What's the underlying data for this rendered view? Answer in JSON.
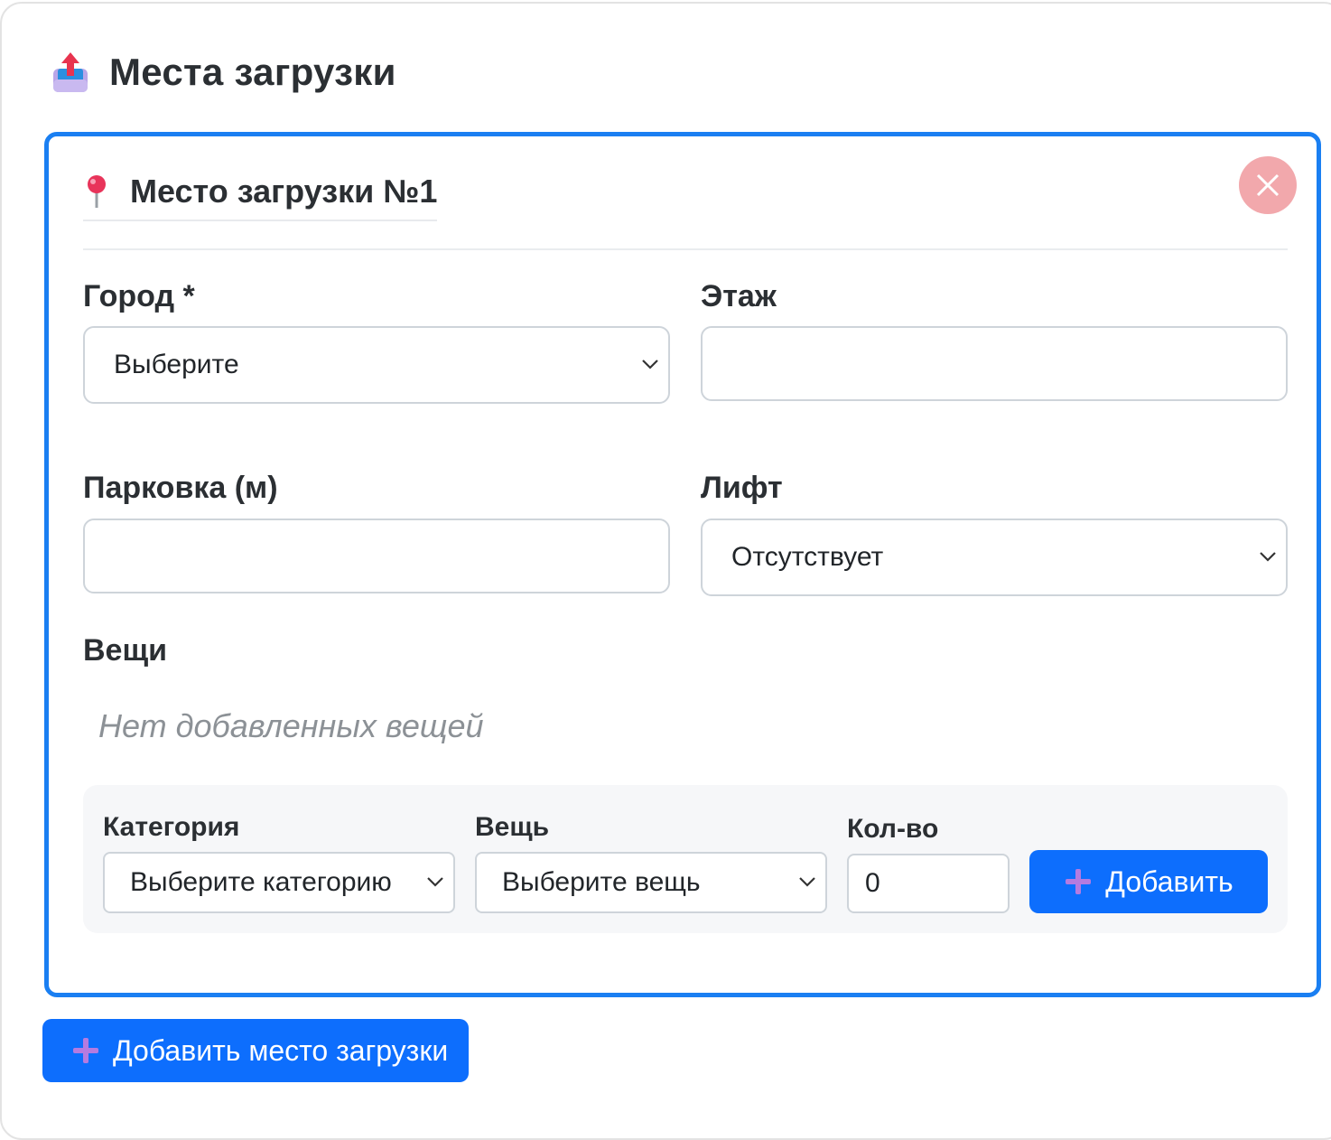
{
  "section": {
    "title": "Места загрузки",
    "icon": "outbox-tray-icon"
  },
  "location_card": {
    "title": "Место загрузки №1",
    "icon": "round-pushpin-icon",
    "remove_icon": "close-icon",
    "fields": {
      "city": {
        "label": "Город *",
        "selected": "Выберите"
      },
      "floor": {
        "label": "Этаж",
        "value": ""
      },
      "parking": {
        "label": "Парковка (м)",
        "value": ""
      },
      "elevator": {
        "label": "Лифт",
        "selected": "Отсутствует"
      }
    },
    "items": {
      "label": "Вещи",
      "empty_text": "Нет добавленных вещей",
      "add_form": {
        "category_label": "Категория",
        "category_selected": "Выберите категорию",
        "item_label": "Вещь",
        "item_selected": "Выберите вещь",
        "qty_label": "Кол-во",
        "qty_value": "0",
        "add_button": "Добавить"
      }
    }
  },
  "add_location_button": "Добавить место загрузки",
  "colors": {
    "accent": "#0d6efd",
    "card_border": "#1a7ff2",
    "remove_button": "#f2a8ac",
    "muted_text": "#8c9196"
  }
}
